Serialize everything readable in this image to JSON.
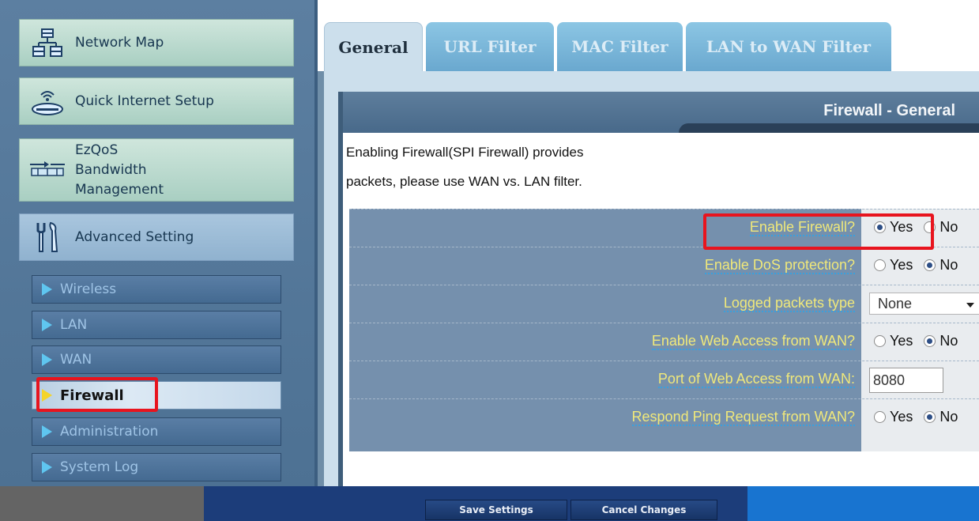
{
  "sidebar": {
    "menu": [
      {
        "label": "Network Map",
        "icon": "network-map-icon"
      },
      {
        "label": "Quick Internet Setup",
        "icon": "router-icon"
      },
      {
        "label_lines": [
          "EzQoS",
          "Bandwidth",
          "Management"
        ],
        "icon": "bandwidth-icon"
      },
      {
        "label": "Advanced Setting",
        "icon": "tools-icon"
      }
    ],
    "subitems": [
      "Wireless",
      "LAN",
      "WAN",
      "Firewall",
      "Administration",
      "System Log"
    ],
    "selected": "Firewall"
  },
  "tabs": [
    "General",
    "URL Filter",
    "MAC Filter",
    "LAN to WAN Filter"
  ],
  "active_tab": "General",
  "panel": {
    "title": "Firewall - General",
    "desc_line1": "Enabling Firewall(SPI Firewall) provides",
    "desc_line2": "packets, please use WAN vs. LAN filter."
  },
  "form": {
    "enable_firewall": {
      "label": "Enable Firewall?",
      "yes": "Yes",
      "no": "No",
      "selected": "Yes"
    },
    "dos": {
      "label": "Enable DoS protection?",
      "yes": "Yes",
      "no": "No",
      "selected": "No"
    },
    "logged": {
      "label": "Logged packets type",
      "value": "None"
    },
    "web_access": {
      "label": "Enable Web Access from WAN?",
      "yes": "Yes",
      "no": "No",
      "selected": "No"
    },
    "web_port": {
      "label": "Port of Web Access from WAN:",
      "value": "8080"
    },
    "ping": {
      "label": "Respond Ping Request from WAN?",
      "yes": "Yes",
      "no": "No",
      "selected": "No"
    }
  },
  "buttons": {
    "save": "Save Settings",
    "cancel": "Cancel Changes"
  },
  "colors": {
    "highlight": "#e8141e",
    "label_text": "#f0e87a",
    "tab_active": "#ccdfec"
  }
}
